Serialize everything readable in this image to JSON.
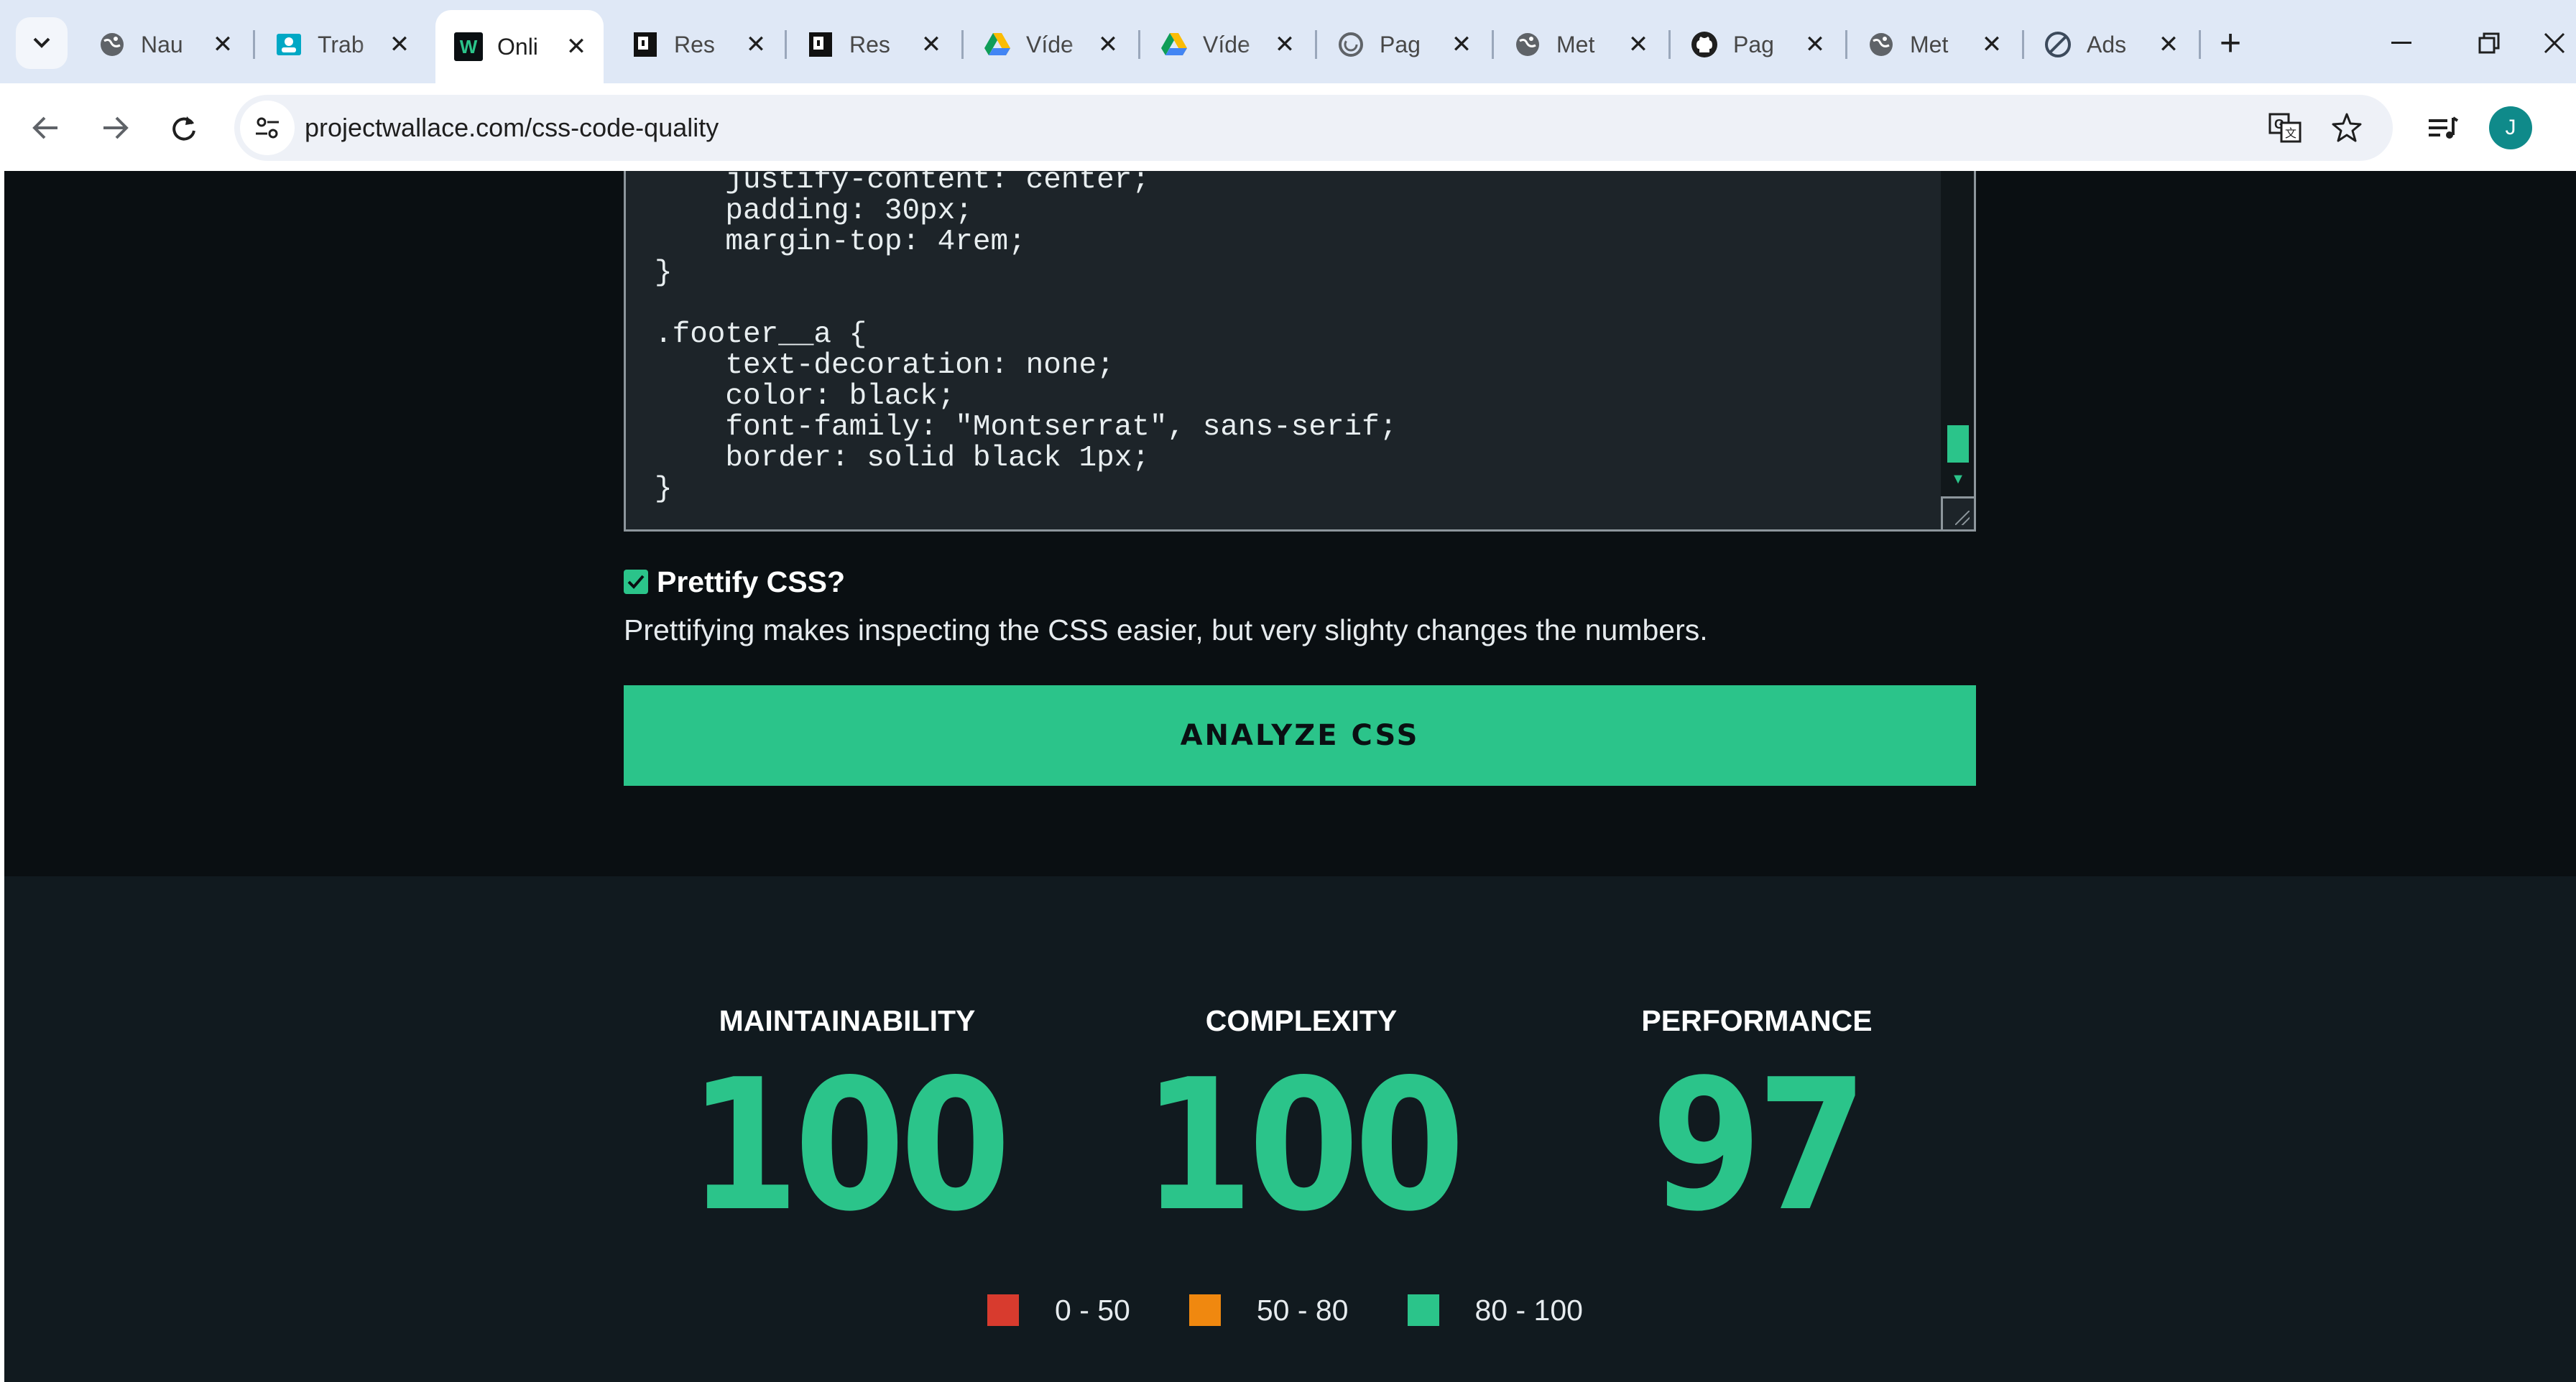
{
  "browser": {
    "tabs": [
      {
        "title": "Nau",
        "icon": "globe-icon"
      },
      {
        "title": "Trab",
        "icon": "contact-card-icon"
      },
      {
        "title": "Onli",
        "icon": "w-logo-icon"
      },
      {
        "title": "Res",
        "icon": "document-logo-icon"
      },
      {
        "title": "Res",
        "icon": "document-logo-icon"
      },
      {
        "title": "Víde",
        "icon": "google-drive-icon"
      },
      {
        "title": "Víde",
        "icon": "google-drive-icon"
      },
      {
        "title": "Pag",
        "icon": "loading-ring-icon"
      },
      {
        "title": "Met",
        "icon": "globe-icon"
      },
      {
        "title": "Pag",
        "icon": "github-icon"
      },
      {
        "title": "Met",
        "icon": "globe-icon"
      },
      {
        "title": "Ads",
        "icon": "no-entry-icon"
      }
    ],
    "active_tab_index": 2,
    "url": "projectwallace.com/css-code-quality",
    "profile_initial": "J"
  },
  "editor": {
    "code": "    justify-content: center;\n    padding: 30px;\n    margin-top: 4rem;\n}\n\n.footer__a {\n    text-decoration: none;\n    color: black;\n    font-family: \"Montserrat\", sans-serif;\n    border: solid black 1px;\n}"
  },
  "prettify": {
    "checked": true,
    "label": "Prettify CSS?",
    "help": "Prettifying makes inspecting the CSS easier, but very slighty changes the numbers."
  },
  "analyze_button": "ANALYZE CSS",
  "scores": [
    {
      "label": "MAINTAINABILITY",
      "value": "100"
    },
    {
      "label": "COMPLEXITY",
      "value": "100"
    },
    {
      "label": "PERFORMANCE",
      "value": "97"
    }
  ],
  "legend": [
    {
      "range": "0 - 50",
      "color": "#d83b2e"
    },
    {
      "range": "50 - 80",
      "color": "#f0880f"
    },
    {
      "range": "80 - 100",
      "color": "#2bc48a"
    }
  ],
  "colors": {
    "accent": "#2bc48a",
    "page_background": "#0a0f12",
    "results_background": "#111a1f"
  }
}
